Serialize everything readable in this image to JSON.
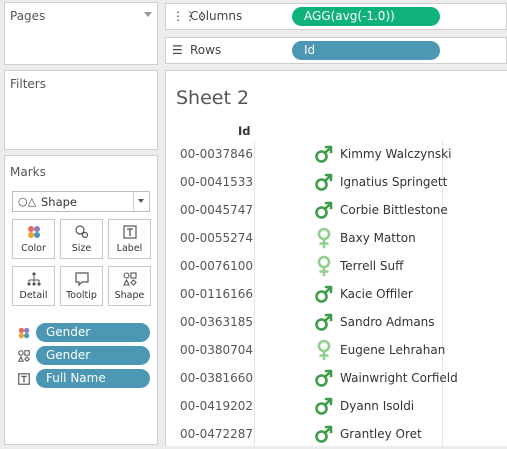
{
  "pages": {
    "title": "Pages"
  },
  "filters": {
    "title": "Filters"
  },
  "marks": {
    "title": "Marks",
    "mark_type": "Shape",
    "buttons": [
      {
        "label": "Color",
        "icon": "color-icon"
      },
      {
        "label": "Size",
        "icon": "size-icon"
      },
      {
        "label": "Label",
        "icon": "label-icon"
      },
      {
        "label": "Detail",
        "icon": "detail-icon"
      },
      {
        "label": "Tooltip",
        "icon": "tooltip-icon"
      },
      {
        "label": "Shape",
        "icon": "shape-icon"
      }
    ],
    "fields": [
      {
        "label": "Gender",
        "icon": "color-icon"
      },
      {
        "label": "Gender",
        "icon": "shape-icon"
      },
      {
        "label": "Full Name",
        "icon": "label-icon"
      }
    ]
  },
  "shelves": {
    "columns": {
      "label": "Columns",
      "pill": "AGG(avg(-1.0))",
      "pill_color": "#10b27b"
    },
    "rows": {
      "label": "Rows",
      "pill": "Id",
      "pill_color": "#4b97b4"
    }
  },
  "view": {
    "sheet_title": "Sheet 2",
    "column_header": "Id",
    "colors": {
      "male": "#3f9e4a",
      "female": "#8fd18b"
    },
    "rows": [
      {
        "id": "00-0037846",
        "name": "Kimmy Walczynski",
        "gender": "male"
      },
      {
        "id": "00-0041533",
        "name": "Ignatius Springett",
        "gender": "male"
      },
      {
        "id": "00-0045747",
        "name": "Corbie Bittlestone",
        "gender": "male"
      },
      {
        "id": "00-0055274",
        "name": "Baxy Matton",
        "gender": "female"
      },
      {
        "id": "00-0076100",
        "name": "Terrell Suff",
        "gender": "female"
      },
      {
        "id": "00-0116166",
        "name": "Kacie Offiler",
        "gender": "male"
      },
      {
        "id": "00-0363185",
        "name": "Sandro Admans",
        "gender": "male"
      },
      {
        "id": "00-0380704",
        "name": "Eugene Lehrahan",
        "gender": "female"
      },
      {
        "id": "00-0381660",
        "name": "Wainwright Corfield",
        "gender": "male"
      },
      {
        "id": "00-0419202",
        "name": "Dyann Isoldi",
        "gender": "male"
      },
      {
        "id": "00-0472287",
        "name": "Grantley Oret",
        "gender": "male"
      }
    ]
  }
}
